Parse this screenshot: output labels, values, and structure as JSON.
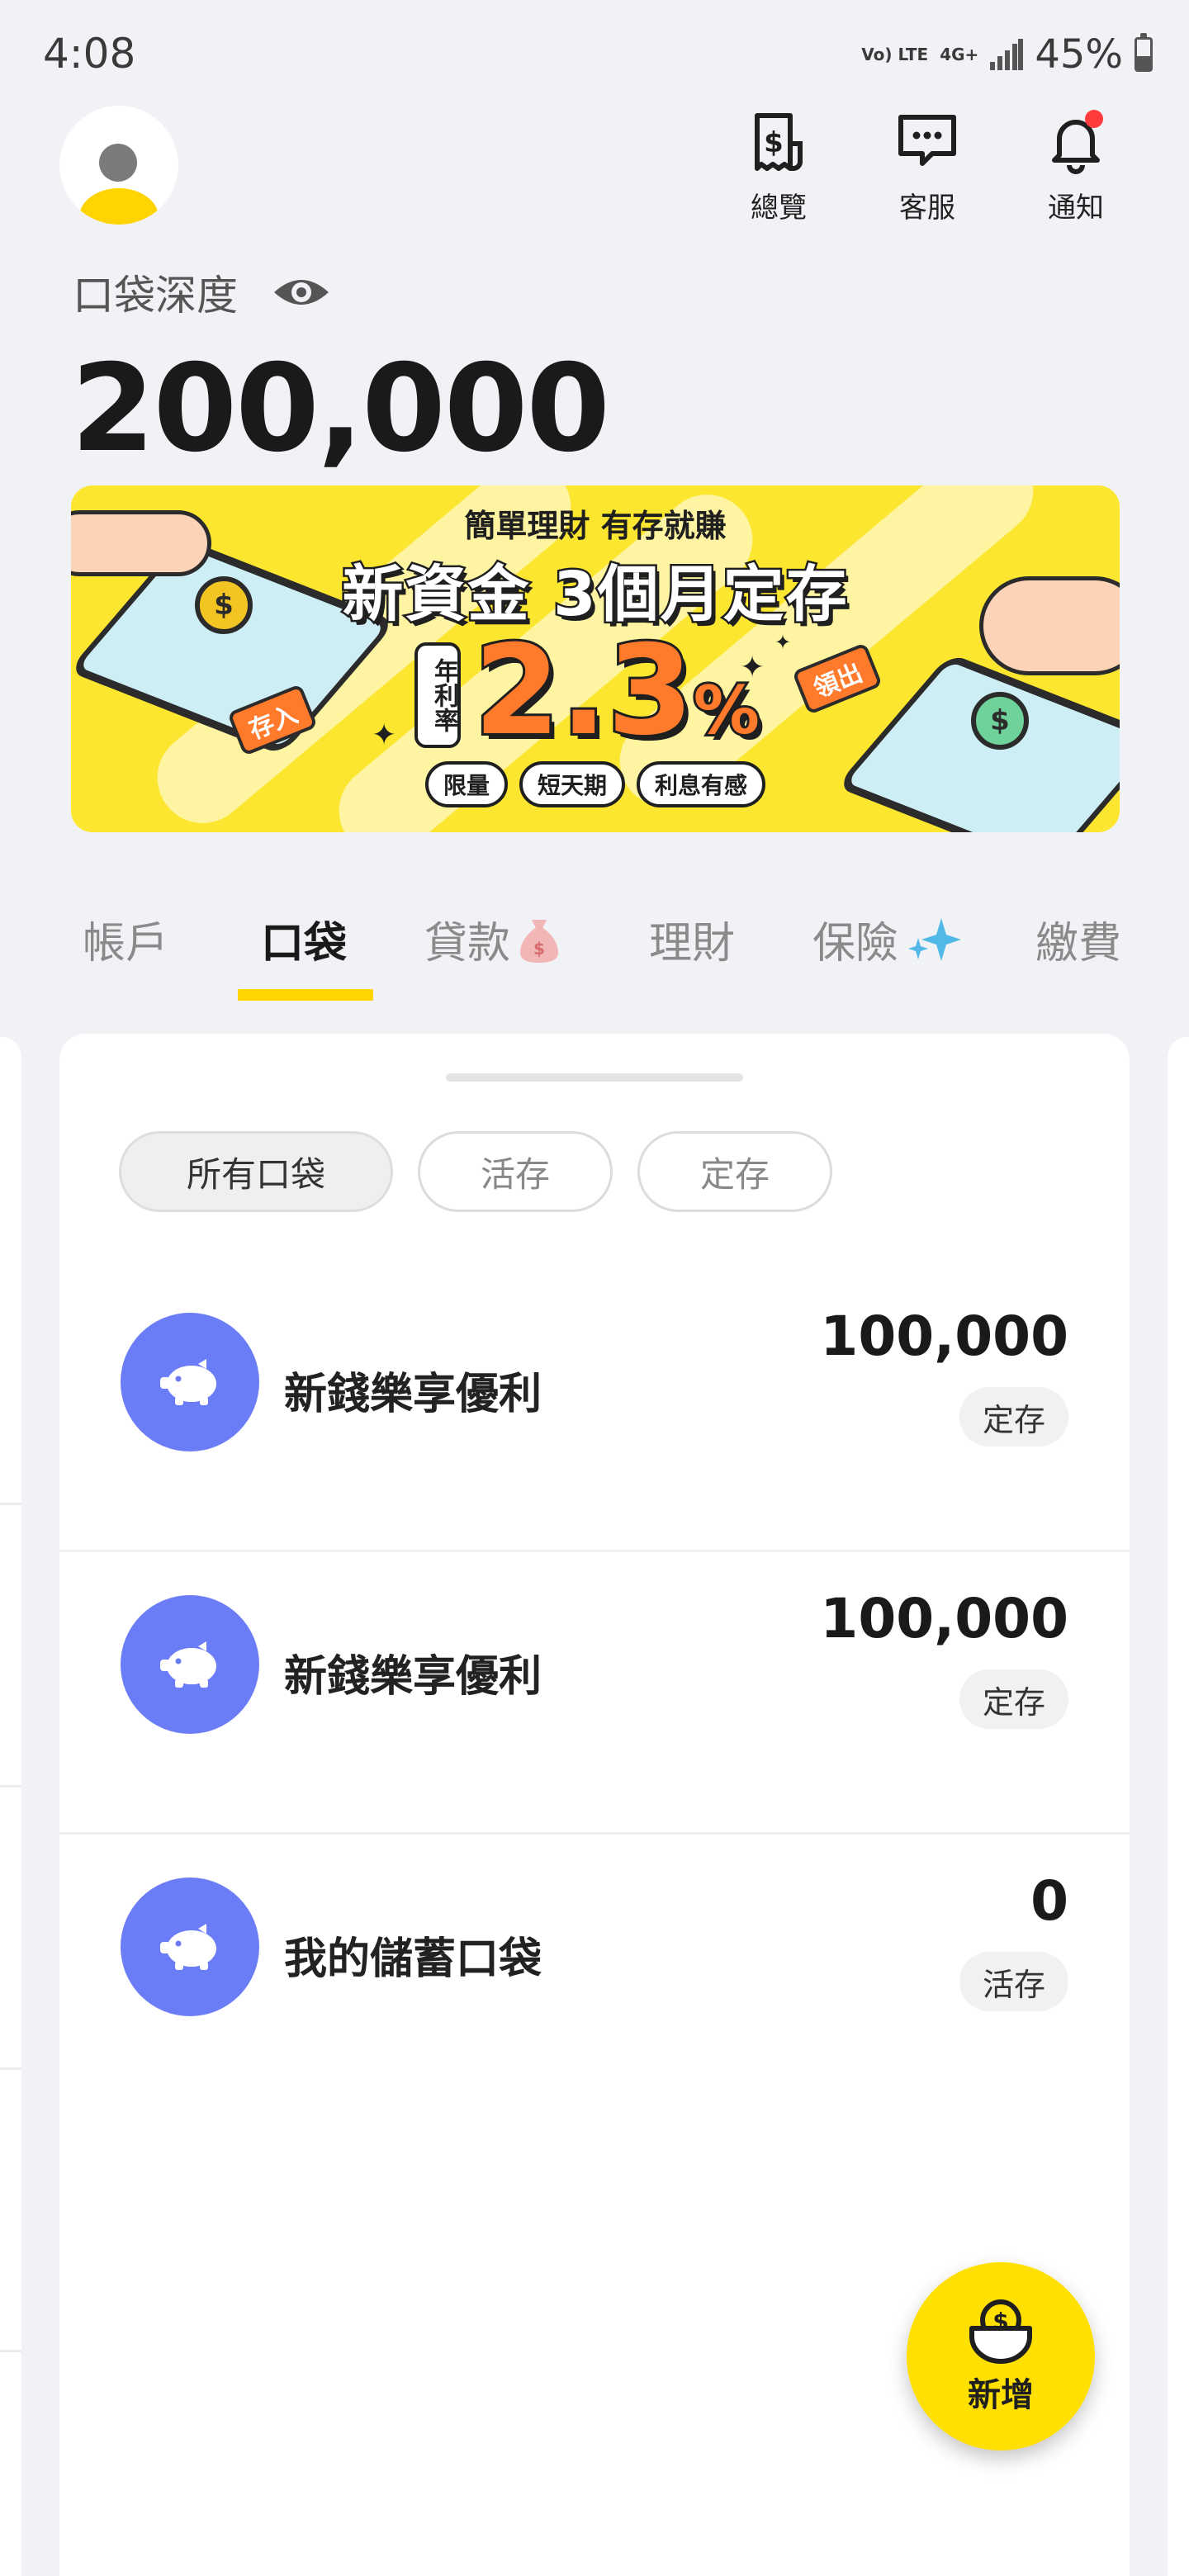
{
  "status_bar": {
    "time": "4:08",
    "volte": "Vo) LTE",
    "network": "4G+",
    "battery": "45%"
  },
  "header": {
    "actions": [
      {
        "label": "總覽",
        "icon": "dollar-receipt-icon"
      },
      {
        "label": "客服",
        "icon": "chat-bubble-icon"
      },
      {
        "label": "通知",
        "icon": "bell-icon",
        "has_badge": true
      }
    ],
    "balance_label": "口袋深度",
    "balance_value": "200,000"
  },
  "banner": {
    "subtitle": "簡單理財 有存就賺",
    "title": "新資金 3個月定存",
    "rate_label": "年利率",
    "rate_value": "2.3",
    "rate_unit": "%",
    "tag_in": "存入",
    "tag_out": "領出",
    "pills": [
      "限量",
      "短天期",
      "利息有感"
    ]
  },
  "tabs": [
    {
      "label": "帳戶",
      "active": false
    },
    {
      "label": "口袋",
      "active": true
    },
    {
      "label": "貸款",
      "active": false,
      "icon": "money-bag-icon"
    },
    {
      "label": "理財",
      "active": false
    },
    {
      "label": "保險",
      "active": false,
      "icon": "sparkle-icon"
    },
    {
      "label": "繳費",
      "active": false
    }
  ],
  "filters": [
    {
      "label": "所有口袋",
      "active": true
    },
    {
      "label": "活存",
      "active": false
    },
    {
      "label": "定存",
      "active": false
    }
  ],
  "pockets": [
    {
      "name": "新錢樂享優利",
      "amount": "100,000",
      "type": "定存"
    },
    {
      "name": "新錢樂享優利",
      "amount": "100,000",
      "type": "定存"
    },
    {
      "name": "我的儲蓄口袋",
      "amount": "0",
      "type": "活存"
    }
  ],
  "fab": {
    "label": "新增"
  },
  "colors": {
    "brand_yellow": "#ffd400",
    "pocket_blue": "#6a7cf6",
    "accent_orange": "#ff7a2a",
    "badge_red": "#ff3b3b"
  }
}
